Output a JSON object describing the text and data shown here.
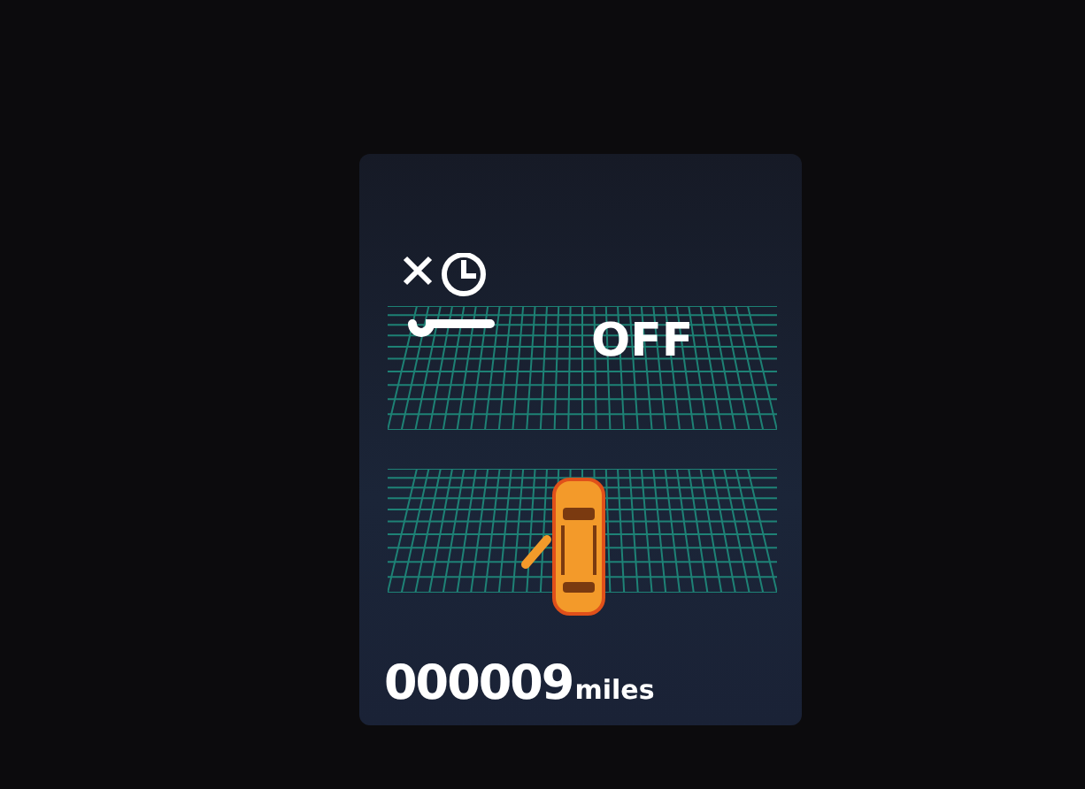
{
  "maintenance_reminder": {
    "status": "OFF"
  },
  "door_warning": {
    "front_left_door_open": true
  },
  "odometer": {
    "value": "000009",
    "unit": "miles"
  }
}
